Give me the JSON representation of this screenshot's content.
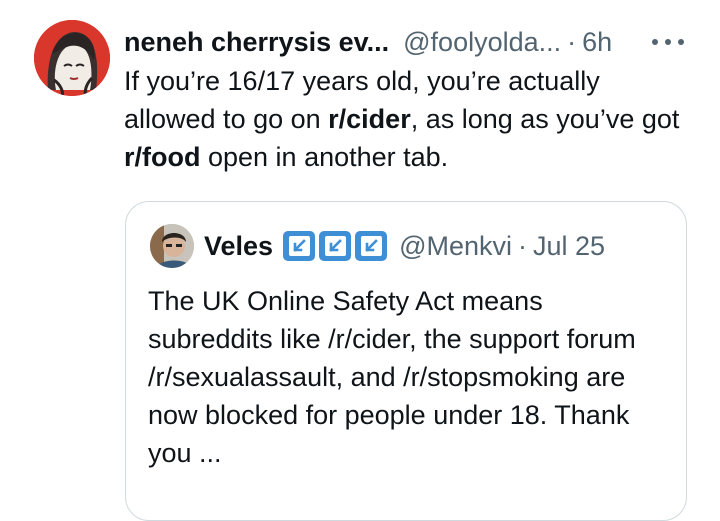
{
  "tweet": {
    "display_name": "neneh cherrysis ev...",
    "handle": "@foolyolda...",
    "separator": "·",
    "time": "6h",
    "text_parts": [
      "If you’re 16/17 years old, you’re actually allowed to go on ",
      "r/cider",
      ", as long as you’ve got ",
      "r/food",
      " open in another tab."
    ]
  },
  "quoted_tweet": {
    "display_name": "Veles",
    "handle": "@Menkvi",
    "separator": "·",
    "date": "Jul 25",
    "text": "The UK Online Safety Act means subreddits like /r/cider, the support forum /r/sexualassault, and /r/stopsmoking are now blocked for people under 18. Thank you ..."
  },
  "icons": {
    "more": "more-horizontal-icon",
    "badge": "arrow-down-left-icon"
  },
  "colors": {
    "text": "#0f1419",
    "secondary_text": "#536471",
    "border": "#cfd9de",
    "badge_blue": "#3f8fd6",
    "avatar_red": "#d9362c"
  }
}
